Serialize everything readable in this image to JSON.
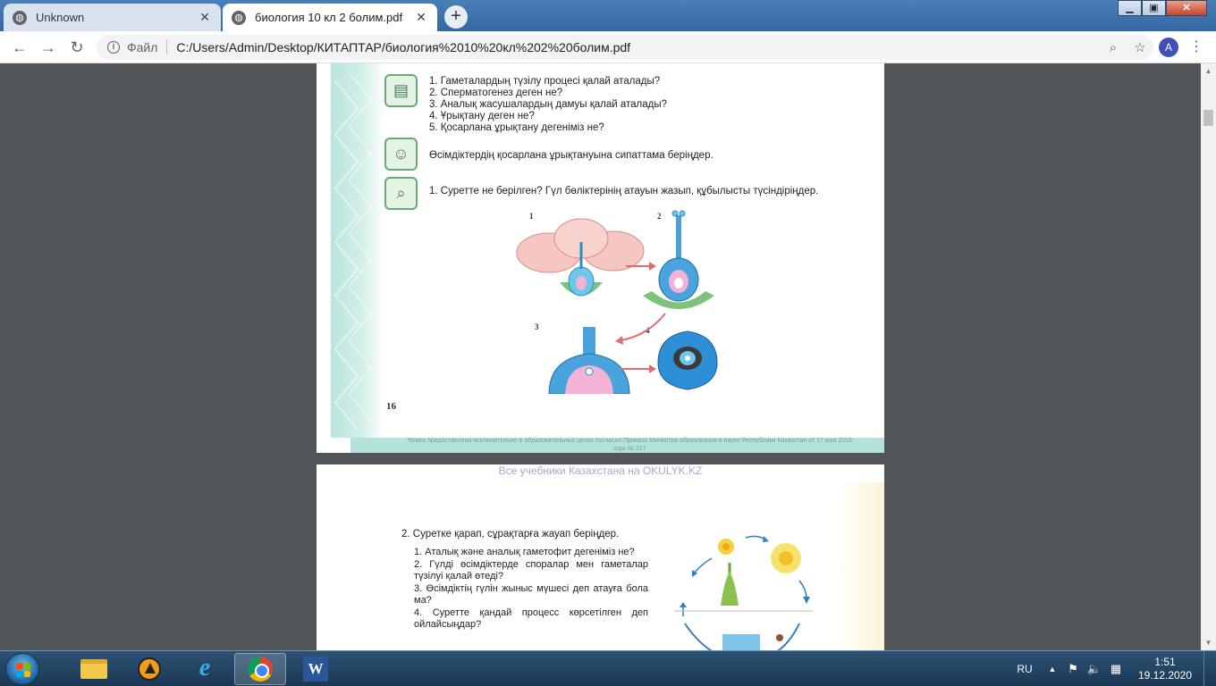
{
  "browser": {
    "tabs": [
      {
        "title": "Unknown",
        "active": false
      },
      {
        "title": "биология 10 кл 2 болим.pdf",
        "active": true
      }
    ],
    "new_tab": "+",
    "window_controls": {
      "minimize": "▁",
      "maximize": "▣",
      "close": "✕"
    },
    "address": {
      "scheme": "Файл",
      "url": "C:/Users/Admin/Desktop/КИТАПТАР/биология%2010%20кл%202%20болим.pdf"
    },
    "profile_initial": "A"
  },
  "page1": {
    "questions": [
      "1. Гаметалардың түзілу процесі қалай аталады?",
      "2. Сперматогенез деген не?",
      "3. Аналық жасушалардың дамуы қалай аталады?",
      "4. Ұрықтану деген не?",
      "5. Қосарлана ұрықтану дегеніміз не?"
    ],
    "task_plant": "Өсімдіктердің қосарлана ұрықтануына сипаттама беріңдер.",
    "task_figure": "1. Суретте не берілген? Гүл бөліктерінің атауын жазып, құбылысты түсіндіріңдер.",
    "figure_labels": [
      "1",
      "2",
      "3",
      "4"
    ],
    "page_number": "16",
    "watermark": "*Книга предоставлена исключительно в образовательных целях согласно Приказа Министра образования и науки Республики Казахстан от 17 мая 2019 года № 217"
  },
  "page2": {
    "okulyk": "Все учебники Казахстана на OKULYK.KZ",
    "question": "2. Суретке қарап, сұрақтарға жауап беріңдер.",
    "subquestions": [
      "1. Аталық және аналық гаметофит дегеніміз не?",
      "2. Гүлді өсімдіктерде споралар мен гаметалар түзілуі қалай өтеді?",
      "3. Өсімдіктің гүлін жыныс мүшесі деп атауға бола ма?",
      "4. Суретте қандай процесс көрсетілген деп ойлайсыңдар?"
    ]
  },
  "taskbar": {
    "language": "RU",
    "time": "1:51",
    "date": "19.12.2020"
  },
  "colors": {
    "tabstrip": "#3c6ea8",
    "viewer_bg": "#525659",
    "page_teal": "#b9e5df",
    "taskbar": "#1b3753"
  }
}
